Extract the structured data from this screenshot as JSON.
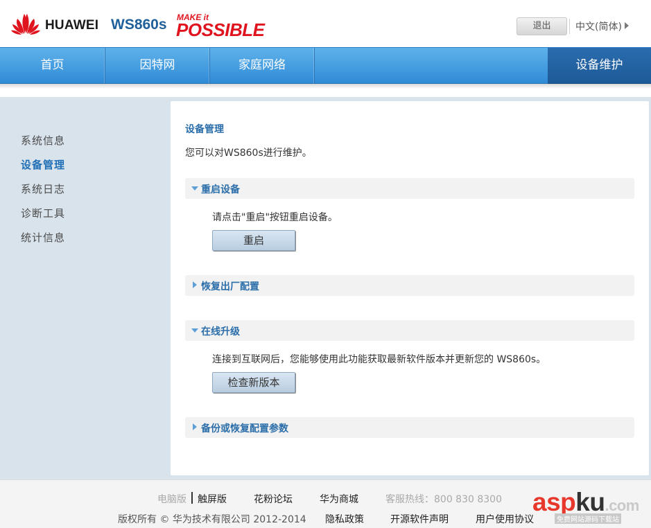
{
  "header": {
    "brand": "HUAWEI",
    "model": "WS860s",
    "slogan_top": "MAKE it",
    "slogan_main": "POSSIBLE",
    "logout_label": "退出",
    "language_label": "中文(简体)"
  },
  "nav": {
    "items": [
      {
        "label": "首页"
      },
      {
        "label": "因特网"
      },
      {
        "label": "家庭网络"
      },
      {
        "label": "设备维护",
        "active": true
      }
    ]
  },
  "sidebar": {
    "items": [
      {
        "label": "系统信息"
      },
      {
        "label": "设备管理",
        "active": true
      },
      {
        "label": "系统日志"
      },
      {
        "label": "诊断工具"
      },
      {
        "label": "统计信息"
      }
    ]
  },
  "main": {
    "title": "设备管理",
    "description": "您可以对WS860s进行维护。",
    "sections": [
      {
        "title": "重启设备",
        "expanded": true,
        "text": "请点击\"重启\"按钮重启设备。",
        "button": "重启"
      },
      {
        "title": "恢复出厂配置",
        "expanded": false
      },
      {
        "title": "在线升级",
        "expanded": true,
        "text": "连接到互联网后，您能够使用此功能获取最新软件版本并更新您的 WS860s。",
        "button": "检查新版本"
      },
      {
        "title": "备份或恢复配置参数",
        "expanded": false
      }
    ]
  },
  "footer": {
    "pc_version": "电脑版",
    "touch_version": "触屏版",
    "forum": "花粉论坛",
    "store": "华为商城",
    "hotline": "客服热线：800 830 8300",
    "copyright": "版权所有 © 华为技术有限公司 2012-2014",
    "privacy": "隐私政策",
    "open_source": "开源软件声明",
    "user_agreement": "用户使用协议"
  },
  "watermark": {
    "text_a": "asp",
    "text_b": "ku",
    "text_c": ".com",
    "sub": "免费网站源码下载站"
  },
  "colors": {
    "nav_blue": "#3d97de",
    "nav_active": "#24629f",
    "accent_blue": "#2b6ea9",
    "brand_red": "#e0141e",
    "body_bg": "#d9e3ec"
  }
}
